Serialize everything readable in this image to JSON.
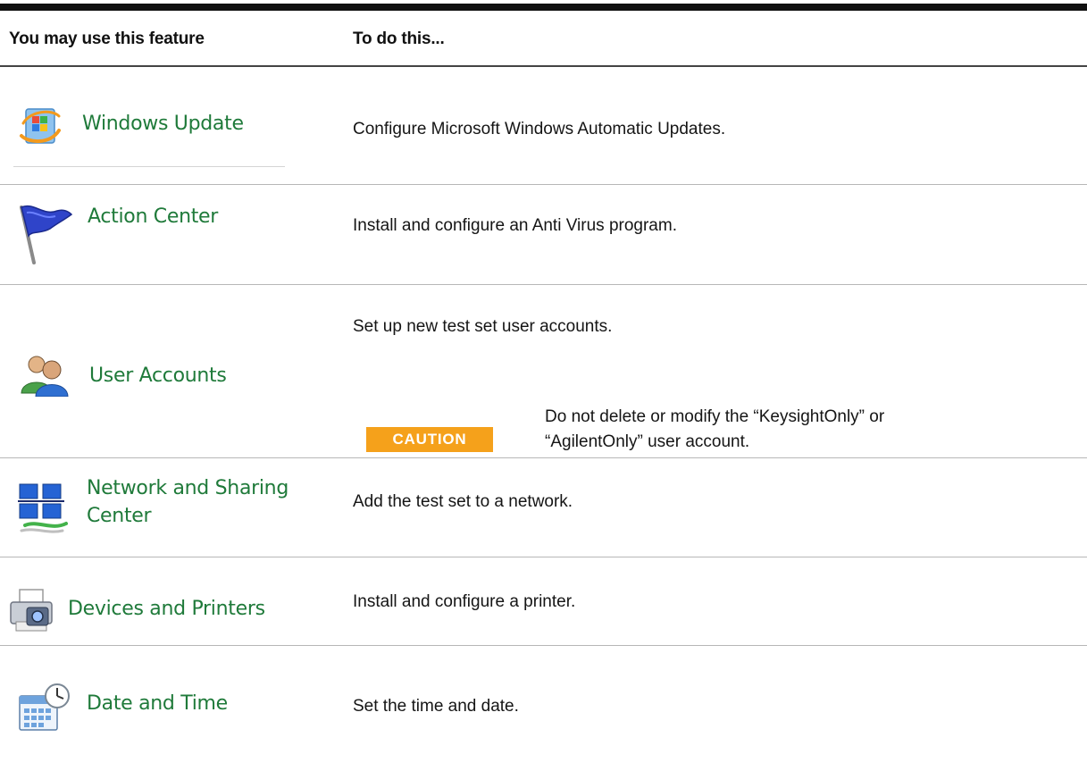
{
  "header": {
    "col_feature": "You may use this feature",
    "col_action": "To do this..."
  },
  "rows": [
    {
      "feature": "Windows Update",
      "icon": "windows-update-icon",
      "description": "Configure Microsoft Windows Automatic Updates."
    },
    {
      "feature": "Action Center",
      "icon": "flag-icon",
      "description": "Install and configure an Anti Virus program."
    },
    {
      "feature": "User Accounts",
      "icon": "users-icon",
      "description": "Set up new test set user accounts.",
      "caution": {
        "badge": "CAUTION",
        "line1": "Do not delete or modify the “KeysightOnly” or",
        "line2": "“AgilentOnly” user account."
      }
    },
    {
      "feature_line1": "Network and Sharing",
      "feature_line2": "Center",
      "icon": "network-icon",
      "description": "Add the test set to a network."
    },
    {
      "feature": "Devices and Printers",
      "icon": "printer-camera-icon",
      "description": "Install and configure a printer."
    },
    {
      "feature": "Date and Time",
      "icon": "calendar-clock-icon",
      "description": "Set the time and date."
    }
  ],
  "colors": {
    "label_green": "#1f7a3a",
    "caution_orange": "#f5a11b"
  }
}
